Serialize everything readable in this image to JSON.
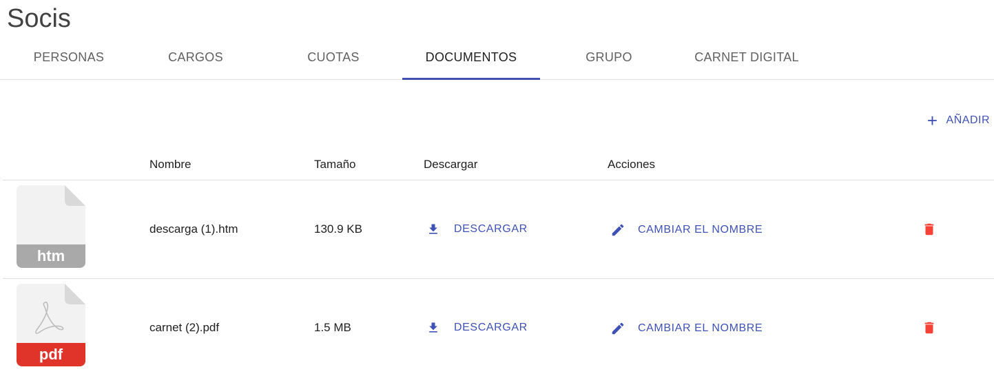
{
  "page": {
    "title": "Socis"
  },
  "tabs": [
    {
      "label": "PERSONAS"
    },
    {
      "label": "CARGOS"
    },
    {
      "label": "CUOTAS"
    },
    {
      "label": "DOCUMENTOS",
      "active": true
    },
    {
      "label": "GRUPO"
    },
    {
      "label": "CARNET DIGITAL"
    }
  ],
  "toolbar": {
    "add_icon": "+",
    "add_label": "AÑADIR"
  },
  "table": {
    "headers": {
      "name": "Nombre",
      "size": "Tamaño",
      "download": "Descargar",
      "actions": "Acciones"
    },
    "rows": [
      {
        "file_type": "htm",
        "name": "descarga (1).htm",
        "size": "130.9 KB",
        "download_label": "DESCARGAR",
        "rename_label": "CAMBIAR EL NOMBRE"
      },
      {
        "file_type": "pdf",
        "name": "carnet (2).pdf",
        "size": "1.5 MB",
        "download_label": "DESCARGAR",
        "rename_label": "CAMBIAR EL NOMBRE"
      }
    ]
  },
  "colors": {
    "accent": "#3f51b5",
    "delete": "#f44336",
    "htm_badge": "#a9a9a9",
    "pdf_badge": "#e0342b"
  }
}
